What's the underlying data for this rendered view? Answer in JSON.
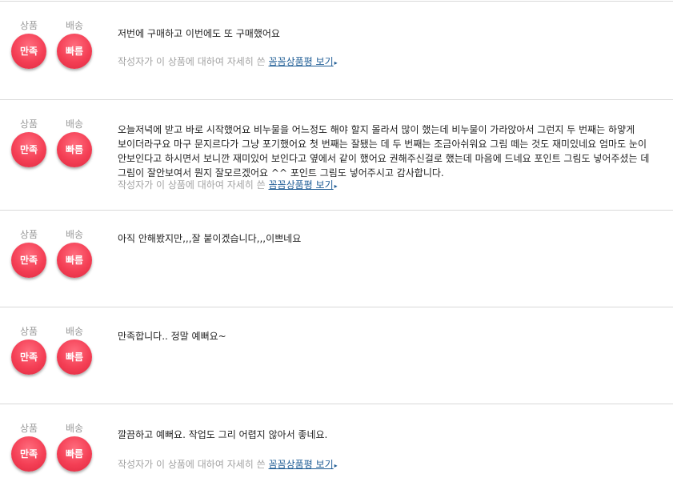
{
  "labels": {
    "product": "상품",
    "delivery": "배송",
    "satisfied": "만족",
    "fast": "빠름",
    "more_prefix": "작성자가 이 상품에 대하여 자세히 쓴",
    "more_link": "꼼꼼상품평 보기",
    "arrow": "▸"
  },
  "reviews": [
    {
      "text": "저번에 구매하고 이번에도 또 구매했어요"
    },
    {
      "text": "오늘저녁에 받고 바로 시작했어요 비누물을 어느정도 해야 할지 몰라서 많이 했는데 비누물이 가라앉아서 그런지 두 번째는 하얗게 보이더라구요 마구 문지르다가 그냥 포기했어요 첫 번째는 잘됐는 데 두 번째는 조금아쉬워요 그림 떼는 것도 재미있네요 엄마도 눈이 안보인다고 하시면서 보니깐 재미있어 보인다고 옆에서 같이 했어요 권해주신걸로 했는데 마음에 드네요 포인트 그림도 넣어주셨는 데 그림이 잘안보여서 뭔지 잘모르겠어요 ^^ 포인트 그림도 넣어주시고 감사합니다."
    },
    {
      "text": "아직 안해봤지만,,,잘 붙이겠습니다,,,이쁘네요"
    },
    {
      "text": "만족합니다.. 정말 예뻐요~"
    },
    {
      "text": "깔끔하고 예뻐요. 작업도 그리 어렵지 않아서 좋네요."
    }
  ]
}
